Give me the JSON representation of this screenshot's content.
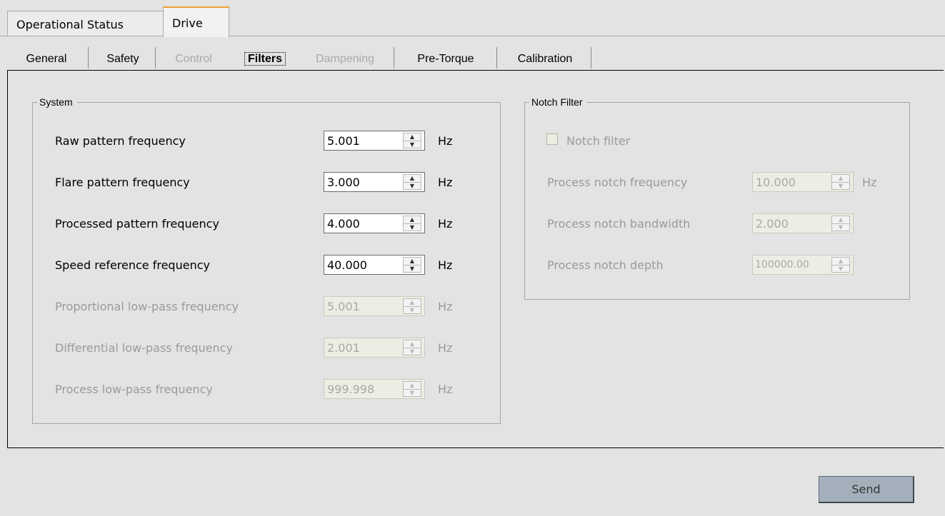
{
  "top_tabs": [
    {
      "label": "Operational Status",
      "active": false
    },
    {
      "label": "Drive",
      "active": true
    }
  ],
  "sub_tabs": [
    {
      "label": "General",
      "state": "normal"
    },
    {
      "label": "Safety",
      "state": "normal"
    },
    {
      "label": "Control",
      "state": "disabled"
    },
    {
      "label": "Filters",
      "state": "active"
    },
    {
      "label": "Dampening",
      "state": "disabled"
    },
    {
      "label": "Pre-Torque",
      "state": "normal"
    },
    {
      "label": "Calibration",
      "state": "normal"
    }
  ],
  "system": {
    "title": "System",
    "fields": [
      {
        "label": "Raw pattern frequency",
        "value": "5.001",
        "unit": "Hz",
        "enabled": true
      },
      {
        "label": "Flare pattern frequency",
        "value": "3.000",
        "unit": "Hz",
        "enabled": true
      },
      {
        "label": "Processed pattern frequency",
        "value": "4.000",
        "unit": "Hz",
        "enabled": true
      },
      {
        "label": "Speed reference frequency",
        "value": "40.000",
        "unit": "Hz",
        "enabled": true
      },
      {
        "label": "Proportional low-pass frequency",
        "value": "5.001",
        "unit": "Hz",
        "enabled": false
      },
      {
        "label": "Differential low-pass frequency",
        "value": "2.001",
        "unit": "Hz",
        "enabled": false
      },
      {
        "label": "Process low-pass frequency",
        "value": "999.998",
        "unit": "Hz",
        "enabled": false
      }
    ]
  },
  "notch": {
    "title": "Notch Filter",
    "checkbox_label": "Notch filter",
    "checked": false,
    "fields": [
      {
        "label": "Process notch frequency",
        "value": "10.000",
        "unit": "Hz",
        "enabled": false
      },
      {
        "label": "Process notch bandwidth",
        "value": "2.000",
        "unit": "",
        "enabled": false
      },
      {
        "label": "Process notch depth",
        "value": "100000.00",
        "unit": "",
        "enabled": false
      }
    ]
  },
  "send_label": "Send"
}
